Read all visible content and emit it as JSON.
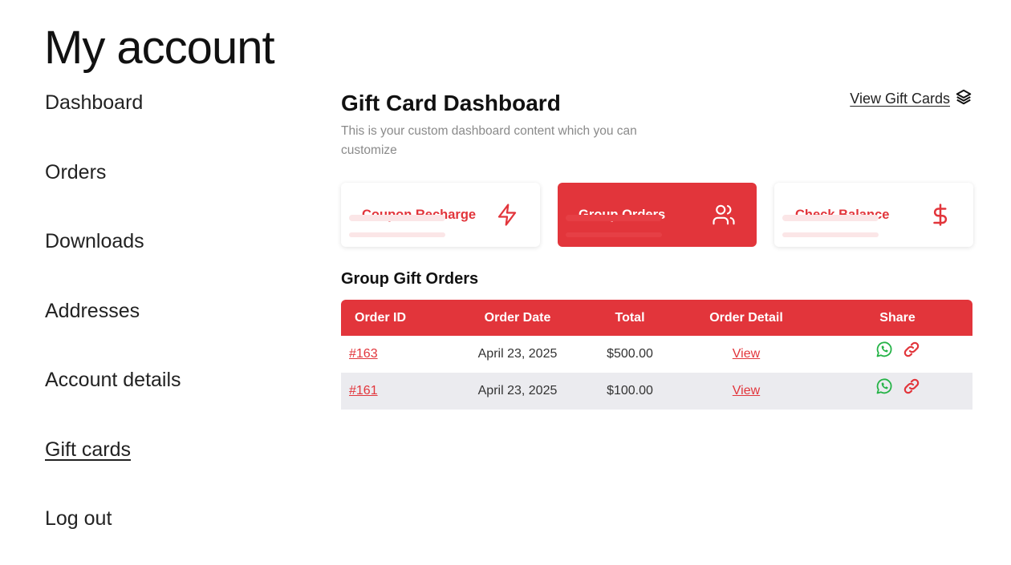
{
  "page": {
    "title": "My account"
  },
  "nav": {
    "items": [
      {
        "label": "Dashboard"
      },
      {
        "label": "Orders"
      },
      {
        "label": "Downloads"
      },
      {
        "label": "Addresses"
      },
      {
        "label": "Account details"
      },
      {
        "label": "Gift cards"
      },
      {
        "label": "Log out"
      }
    ],
    "active": "Gift cards"
  },
  "dashboard": {
    "title": "Gift Card Dashboard",
    "description": "This is your custom dashboard content which you can customize",
    "view_gift_cards_label": "View Gift Cards",
    "view_gift_cards_icon": "layers-icon"
  },
  "cards": [
    {
      "label": "Coupon Recharge",
      "icon": "lightning-icon"
    },
    {
      "label": "Group Orders",
      "icon": "users-icon"
    },
    {
      "label": "Check Balance",
      "icon": "dollar-icon"
    }
  ],
  "group_orders": {
    "title": "Group Gift Orders",
    "columns": [
      "Order ID",
      "Order Date",
      "Total",
      "Order Detail",
      "Share"
    ],
    "rows": [
      {
        "order_id": "#163",
        "date": "April 23, 2025",
        "total": "$500.00",
        "detail": "View"
      },
      {
        "order_id": "#161",
        "date": "April 23, 2025",
        "total": "$100.00",
        "detail": "View"
      }
    ]
  },
  "colors": {
    "accent": "#e2353b",
    "whatsapp": "#25b347",
    "row_alt": "#ebebef",
    "muted_text": "#8a8a8a"
  }
}
